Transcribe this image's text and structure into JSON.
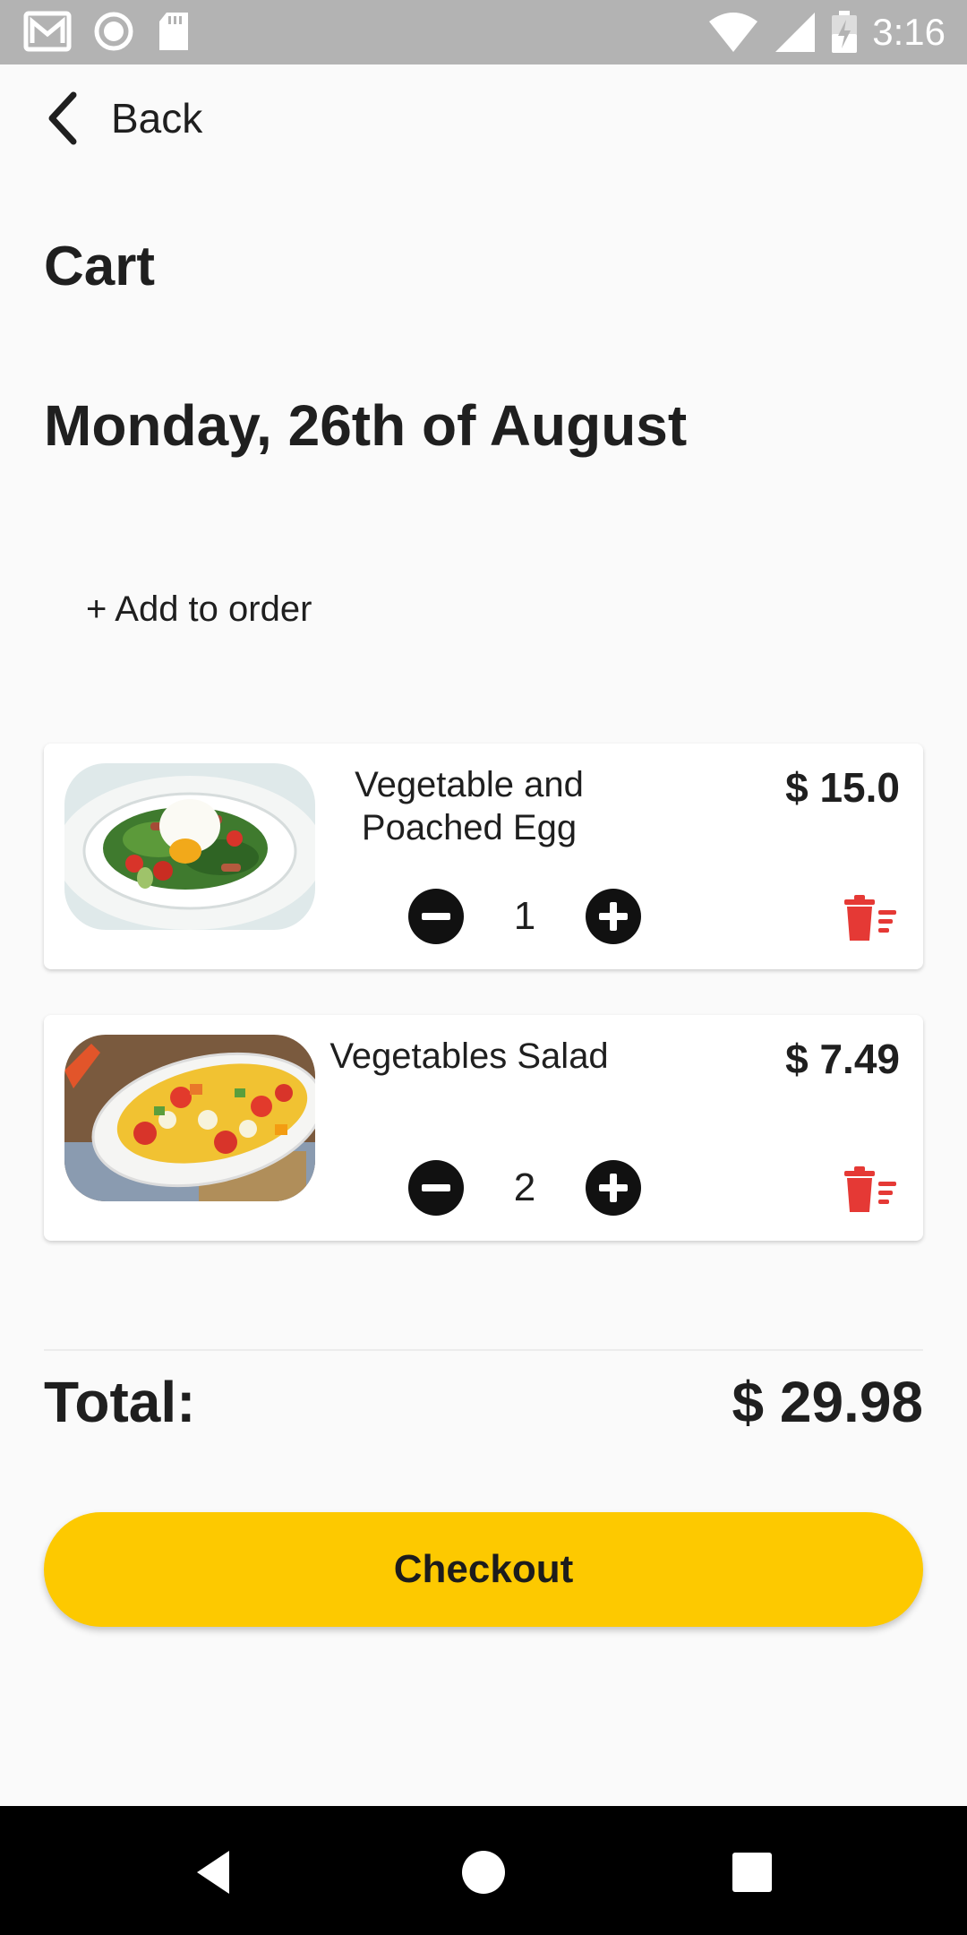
{
  "status_bar": {
    "time": "3:16",
    "icons": [
      "gmail-icon",
      "record-icon",
      "sd-card-icon",
      "wifi-icon",
      "signal-icon",
      "battery-charging-icon"
    ]
  },
  "header": {
    "back_label": "Back",
    "back_icon": "chevron-left-icon"
  },
  "page": {
    "title": "Cart",
    "date": "Monday, 26th of August",
    "add_to_order": "+ Add to order"
  },
  "cart": {
    "items": [
      {
        "name": "Vegetable and Poached Egg",
        "price": "$ 15.0",
        "quantity": "1",
        "image": "poached-egg-salad-photo"
      },
      {
        "name": "Vegetables Salad",
        "price": "$ 7.49",
        "quantity": "2",
        "image": "vegetable-salad-photo"
      }
    ],
    "delete_icon": "trash-icon",
    "delete_color": "#e53935"
  },
  "summary": {
    "total_label": "Total:",
    "total_value": "$ 29.98"
  },
  "checkout": {
    "label": "Checkout",
    "color": "#fdc900"
  },
  "nav_bar": {
    "buttons": [
      "back-triangle-icon",
      "home-circle-icon",
      "recents-square-icon"
    ]
  }
}
